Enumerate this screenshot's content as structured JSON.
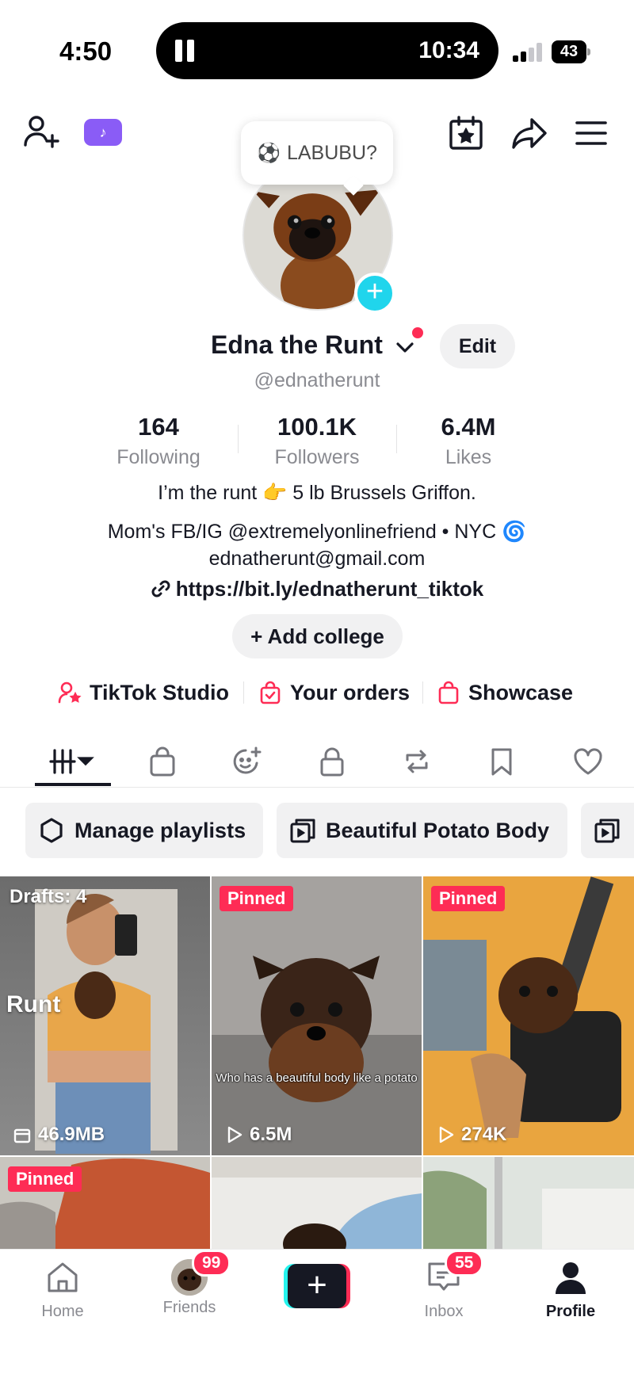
{
  "status_bar": {
    "time": "4:50",
    "activity_time": "10:34",
    "battery": "43"
  },
  "bubble": {
    "text": "LABUBU?"
  },
  "profile": {
    "name": "Edna the Runt",
    "handle": "@ednatherunt",
    "edit_label": "Edit"
  },
  "stats": [
    {
      "value": "164",
      "label": "Following"
    },
    {
      "value": "100.1K",
      "label": "Followers"
    },
    {
      "value": "6.4M",
      "label": "Likes"
    }
  ],
  "bio": {
    "line1": "I’m the runt 👉 5 lb Brussels Griffon.",
    "line2": "Mom's FB/IG @extremelyonlinefriend • NYC 🌀",
    "line3": "ednatherunt@gmail.com",
    "link": "https://bit.ly/ednatherunt_tiktok"
  },
  "add_college": "+ Add college",
  "shortcuts": [
    {
      "label": "TikTok Studio",
      "icon": "creator-star-icon"
    },
    {
      "label": "Your orders",
      "icon": "orders-bag-icon"
    },
    {
      "label": "Showcase",
      "icon": "showcase-bag-icon"
    }
  ],
  "tabs": [
    {
      "name": "videos",
      "icon": "grid-icon"
    },
    {
      "name": "shop",
      "icon": "bag-icon"
    },
    {
      "name": "ai-self",
      "icon": "sparkle-face-icon"
    },
    {
      "name": "private",
      "icon": "lock-icon"
    },
    {
      "name": "reposts",
      "icon": "repost-icon"
    },
    {
      "name": "favorites",
      "icon": "bookmark-icon"
    },
    {
      "name": "liked",
      "icon": "heart-icon"
    }
  ],
  "playlists": [
    {
      "label": "Manage playlists"
    },
    {
      "label": "Beautiful Potato Body"
    }
  ],
  "grid": [
    {
      "drafts": "Drafts: 4",
      "overlay": "Runt",
      "meta": "46.9MB"
    },
    {
      "badge": "Pinned",
      "caption": "Who has a beautiful body like a potato",
      "views": "6.5M"
    },
    {
      "badge": "Pinned",
      "views": "274K"
    },
    {
      "badge": "Pinned"
    },
    {},
    {}
  ],
  "bottom_nav": {
    "home": "Home",
    "friends": "Friends",
    "friends_count": "99",
    "inbox": "Inbox",
    "inbox_count": "55",
    "profile": "Profile"
  },
  "colors": {
    "accent": "#fe2c55",
    "cyan": "#20d5ec",
    "text": "#161823",
    "secondary_text": "#8a8b91",
    "chip_bg": "#f1f1f2"
  }
}
